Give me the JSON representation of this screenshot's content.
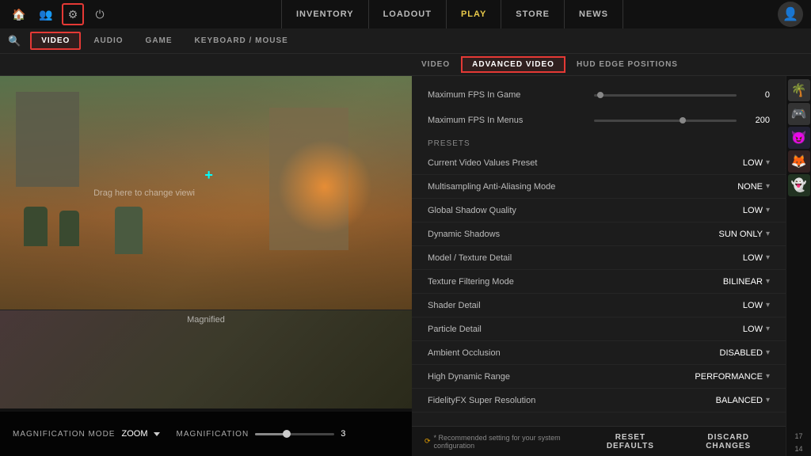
{
  "topnav": {
    "links": [
      {
        "label": "INVENTORY",
        "active": false
      },
      {
        "label": "LOADOUT",
        "active": false
      },
      {
        "label": "PLAY",
        "active": true,
        "highlight": true
      },
      {
        "label": "STORE",
        "active": false
      },
      {
        "label": "NEWS",
        "active": false
      }
    ]
  },
  "settings_tabs": {
    "tabs": [
      {
        "label": "VIDEO",
        "active": true
      },
      {
        "label": "AUDIO",
        "active": false
      },
      {
        "label": "GAME",
        "active": false
      },
      {
        "label": "KEYBOARD / MOUSE",
        "active": false
      }
    ]
  },
  "sub_tabs": {
    "tabs": [
      {
        "label": "VIDEO",
        "active": false
      },
      {
        "label": "ADVANCED VIDEO",
        "active": true
      },
      {
        "label": "HUD EDGE POSITIONS",
        "active": false
      }
    ]
  },
  "fps": {
    "max_in_game_label": "Maximum FPS In Game",
    "max_in_game_value": "0",
    "max_in_game_thumb_pct": 2,
    "max_in_menu_label": "Maximum FPS In Menus",
    "max_in_menu_value": "200",
    "max_in_menu_thumb_pct": 60
  },
  "presets": {
    "label": "Presets",
    "current_label": "Current Video Values Preset",
    "current_value": "LOW"
  },
  "video_settings": [
    {
      "name": "Multisampling Anti-Aliasing Mode",
      "value": "NONE"
    },
    {
      "name": "Global Shadow Quality",
      "value": "LOW"
    },
    {
      "name": "Dynamic Shadows",
      "value": "SUN ONLY"
    },
    {
      "name": "Model / Texture Detail",
      "value": "LOW"
    },
    {
      "name": "Texture Filtering Mode",
      "value": "BILINEAR"
    },
    {
      "name": "Shader Detail",
      "value": "LOW"
    },
    {
      "name": "Particle Detail",
      "value": "LOW"
    },
    {
      "name": "Ambient Occlusion",
      "value": "DISABLED"
    },
    {
      "name": "High Dynamic Range",
      "value": "PERFORMANCE"
    },
    {
      "name": "FidelityFX Super Resolution",
      "value": "BALANCED"
    }
  ],
  "footer": {
    "note": "* Recommended setting for your system configuration",
    "reset_label": "RESET DEFAULTS",
    "discard_label": "DISCARD CHANGES"
  },
  "preview": {
    "drag_text": "Drag here to change viewi",
    "magnified_label": "Magnified"
  },
  "bottom_controls": {
    "magnification_mode_label": "Magnification Mode",
    "magnification_mode_value": "ZOOM",
    "magnification_label": "Magnification",
    "magnification_value": "3"
  }
}
